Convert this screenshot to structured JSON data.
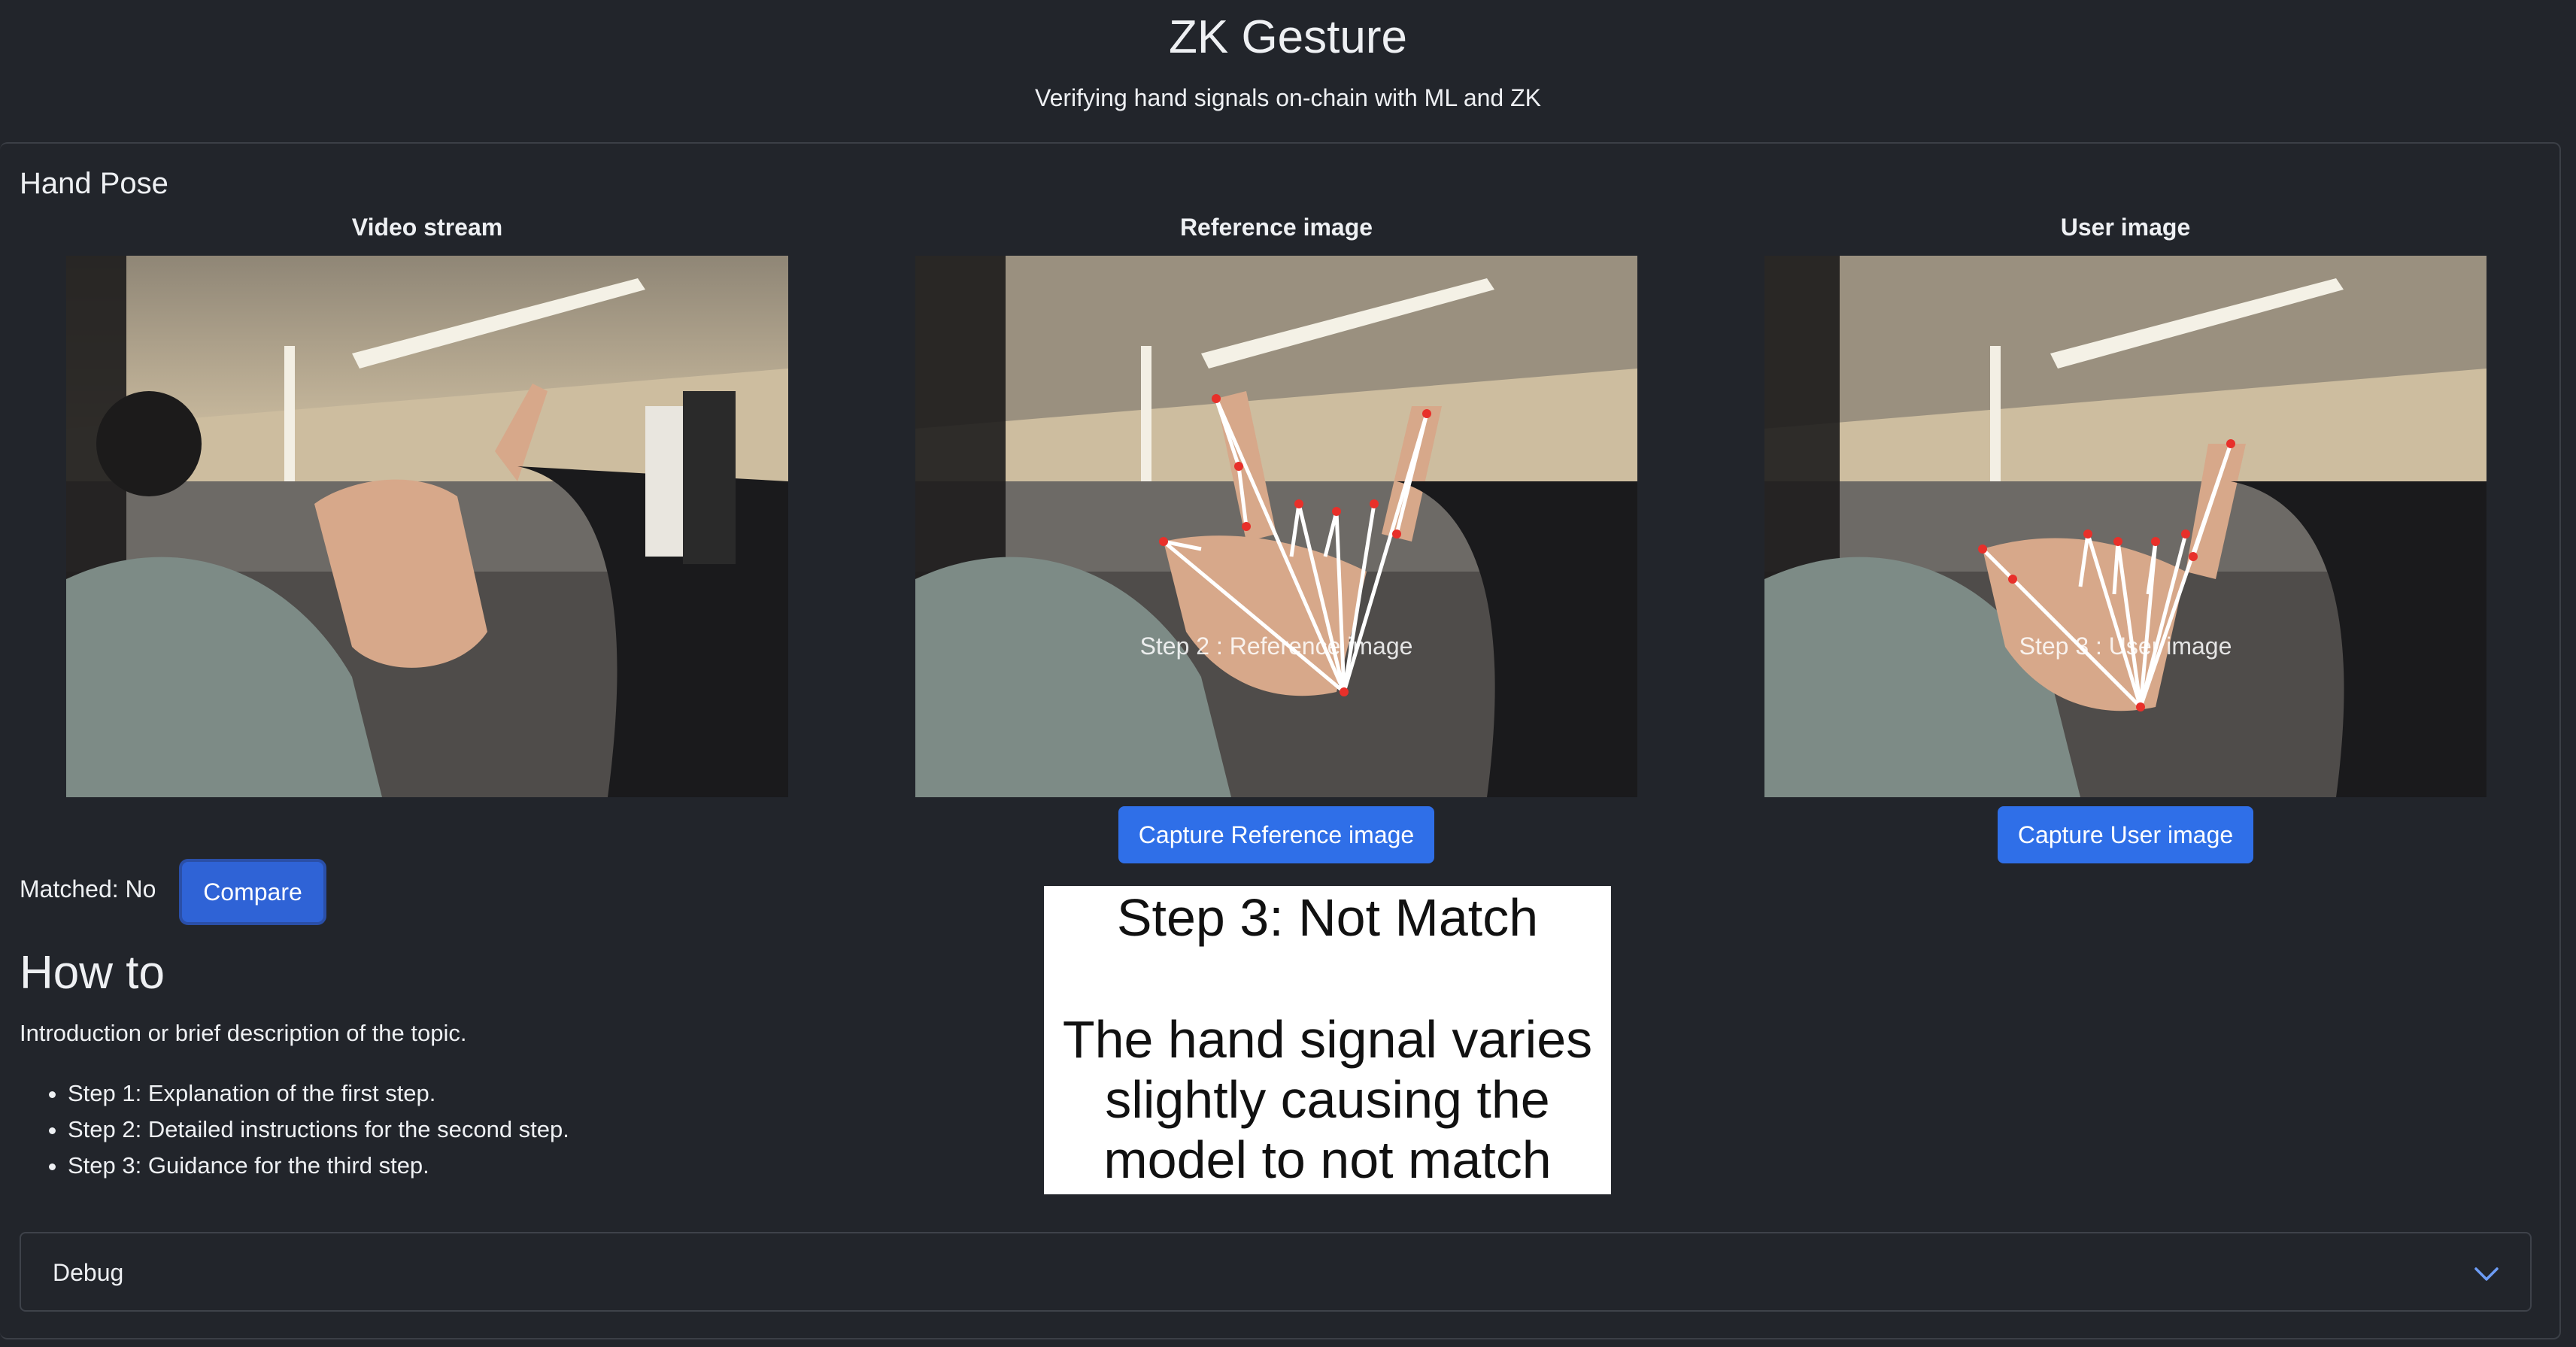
{
  "header": {
    "title": "ZK Gesture",
    "subtitle": "Verifying hand signals on-chain with ML and ZK"
  },
  "section": {
    "title": "Hand Pose"
  },
  "columns": [
    {
      "label": "Video stream"
    },
    {
      "label": "Reference image",
      "overlay": "Step 2 : Reference image",
      "button": "Capture Reference image"
    },
    {
      "label": "User image",
      "overlay": "Step 3 : User image",
      "button": "Capture User image"
    }
  ],
  "compare": {
    "matched_label": "Matched: No",
    "button": "Compare"
  },
  "howto": {
    "title": "How to",
    "intro": "Introduction or brief description of the topic.",
    "steps": [
      "Step 1: Explanation of the first step.",
      "Step 2: Detailed instructions for the second step.",
      "Step 3: Guidance for the third step."
    ]
  },
  "caption": {
    "title": "Step 3: Not Match",
    "body_lines": [
      "The hand signal varies",
      "slightly causing the",
      "model to not match"
    ]
  },
  "debug": {
    "label": "Debug"
  },
  "colors": {
    "background": "#22252b",
    "accent": "#2f6fe8",
    "keypoint": "#e8302a"
  }
}
